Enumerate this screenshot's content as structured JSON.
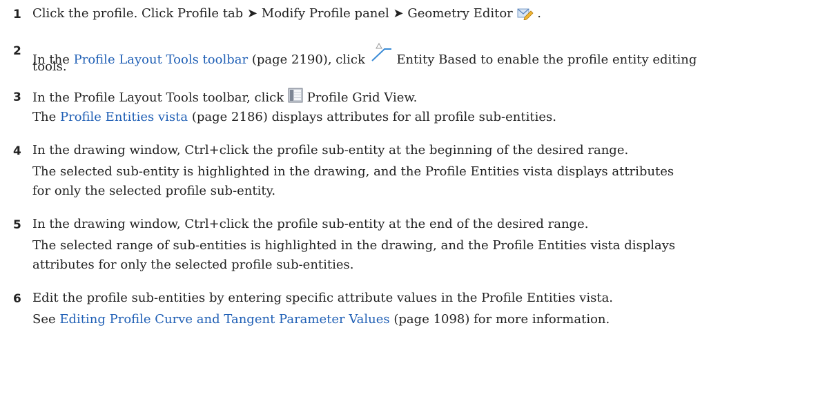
{
  "steps": [
    {
      "number": "1",
      "line1": {
        "a": "Click the profile. Click Profile tab",
        "arrow1": "➤",
        "b": "Modify Profile panel",
        "arrow2": "➤",
        "c": "Geometry Editor",
        "d": "."
      },
      "icon": "geometry-editor-icon"
    },
    {
      "number": "2",
      "line1": {
        "a": "In the ",
        "link": "Profile Layout Tools toolbar",
        "ref": "(page 2190)",
        "b": ", click",
        "c": "Entity Based to enable the profile entity editing"
      },
      "line2": "tools.",
      "icon": "entity-based-icon"
    },
    {
      "number": "3",
      "line1": {
        "a": "In the Profile Layout Tools toolbar, click",
        "b": "Profile Grid View."
      },
      "line2": {
        "a": "The ",
        "link": "Profile Entities vista",
        "ref": "(page 2186)",
        "b": " displays attributes for all profile sub-entities."
      },
      "icon": "profile-grid-view-icon"
    },
    {
      "number": "4",
      "line1": "In the drawing window, Ctrl+click the profile sub-entity at the beginning of the desired range.",
      "line2": "The selected sub-entity is highlighted in the drawing, and the Profile Entities vista displays attributes",
      "line3": "for only the selected profile sub-entity."
    },
    {
      "number": "5",
      "line1": "In the drawing window, Ctrl+click the profile sub-entity at the end of the desired range.",
      "line2": "The selected range of sub-entities is highlighted in the drawing, and the Profile Entities vista displays",
      "line3": "attributes for only the selected profile sub-entities."
    },
    {
      "number": "6",
      "line1": "Edit the profile sub-entities by entering specific attribute values in the Profile Entities vista.",
      "line2": {
        "a": "See ",
        "link": "Editing Profile Curve and Tangent Parameter Values",
        "ref": "(page 1098)",
        "b": " for more information."
      }
    }
  ],
  "colors": {
    "text": "#222222",
    "link": "#1f5fb5"
  }
}
